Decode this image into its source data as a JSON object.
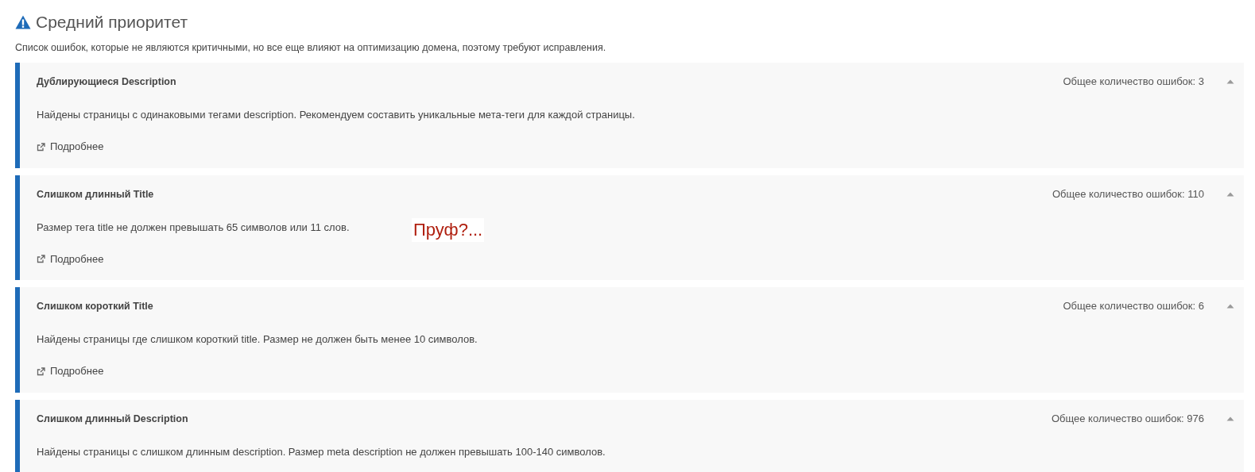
{
  "section": {
    "title": "Средний приоритет",
    "description": "Список ошибок, которые не являются критичными, но все еще влияют на оптимизацию домена, поэтому требуют исправления."
  },
  "issues": [
    {
      "title": "Дублирующиеся Description",
      "count": "Общее количество ошибок: 3",
      "expanded": true,
      "text": "Найдены страницы с одинаковыми тегами description. Рекомендуем составить уникальные мета-теги для каждой страницы.",
      "link": "Подробнее"
    },
    {
      "title": "Слишком длинный Title",
      "count": "Общее количество ошибок: 110",
      "expanded": true,
      "text": "Размер тега title не должен превышать 65 символов или 11 слов.",
      "link": "Подробнее",
      "annotation": "Пруф?..."
    },
    {
      "title": "Слишком короткий Title",
      "count": "Общее количество ошибок: 6",
      "expanded": true,
      "text": "Найдены страницы где слишком короткий title. Размер не должен быть менее 10 символов.",
      "link": "Подробнее"
    },
    {
      "title": "Слишком длинный Description",
      "count": "Общее количество ошибок: 976",
      "expanded": true,
      "text": "Найдены страницы с слишком длинным description. Размер meta description не должен превышать 100-140 символов."
    }
  ]
}
